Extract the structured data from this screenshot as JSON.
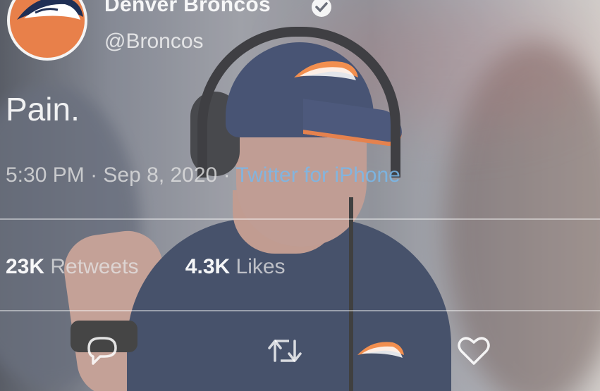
{
  "account": {
    "name": "Denver Broncos",
    "handle": "@Broncos",
    "verified": true
  },
  "tweet": {
    "text": "Pain.",
    "time": "5:30 PM",
    "separator": "·",
    "date": "Sep 8, 2020",
    "source": "Twitter for iPhone"
  },
  "stats": {
    "retweets_count": "23K",
    "retweets_label": "Retweets",
    "likes_count": "4.3K",
    "likes_label": "Likes"
  },
  "actions": {
    "reply_icon": "reply-icon",
    "retweet_icon": "retweet-icon",
    "like_icon": "heart-icon"
  },
  "colors": {
    "brand_orange": "#e8804a",
    "link_blue": "#78b9eb",
    "navy": "#25345a"
  }
}
